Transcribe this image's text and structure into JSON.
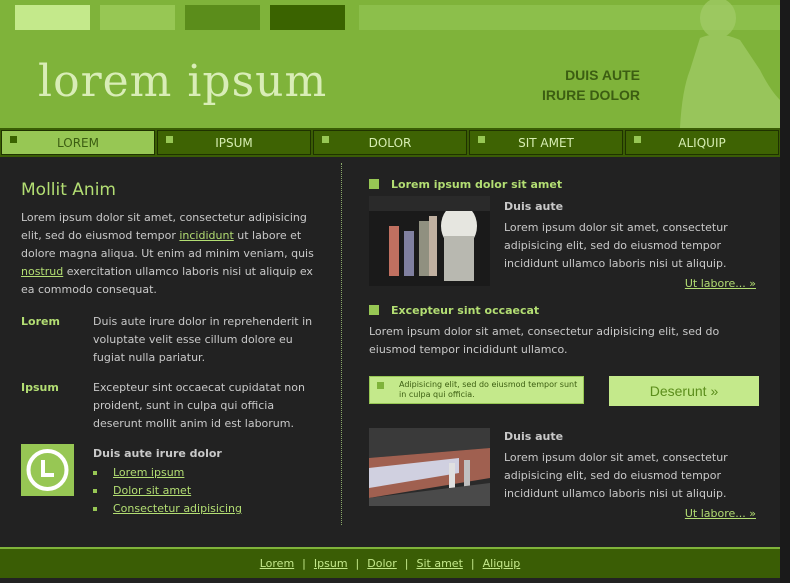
{
  "header": {
    "logo_text": "lorem ipsum",
    "tagline_line1": "DUIS AUTE",
    "tagline_line2": "IRURE DOLOR",
    "colors": {
      "light": "#c4e98b",
      "mid": "#97c754",
      "dark": "#5b8d1b",
      "darker": "#3a6300",
      "bg": "#7fb33a"
    }
  },
  "nav": {
    "items": [
      {
        "label": "LOREM",
        "active": true
      },
      {
        "label": "IPSUM",
        "active": false
      },
      {
        "label": "DOLOR",
        "active": false
      },
      {
        "label": "SIT AMET",
        "active": false
      },
      {
        "label": "ALIQUIP",
        "active": false
      }
    ]
  },
  "left": {
    "title": "Mollit Anim",
    "intro_part1": "Lorem ipsum dolor sit amet, consectetur adipisicing elit, sed do eiusmod tempor ",
    "intro_link1": "incididunt",
    "intro_part2": " ut labore et dolore magna aliqua. Ut enim ad minim veniam, quis ",
    "intro_link2": "nostrud",
    "intro_part3": " exercitation ullamco laboris nisi ut aliquip ex ea commodo consequat.",
    "defs": [
      {
        "term": "Lorem",
        "desc": "Duis aute irure dolor in reprehenderit in voluptate velit esse cillum dolore eu fugiat nulla pariatur."
      },
      {
        "term": "Ipsum",
        "desc": "Excepteur sint occaecat cupidatat non proident, sunt in culpa qui officia deserunt mollit anim id est laborum."
      }
    ],
    "links_heading": "Duis aute irure dolor",
    "links": [
      "Lorem ipsum",
      "Dolor sit amet",
      "Consectetur adipisicing"
    ],
    "icon": "clock-icon"
  },
  "right": {
    "section1_heading": "Lorem ipsum dolor sit amet",
    "article1": {
      "title": "Duis aute",
      "body": "Lorem ipsum dolor sit amet, consectetur adipisicing elit, sed do eiusmod tempor incididunt ullamco laboris nisi ut aliquip.",
      "more": "Ut labore... »"
    },
    "section2_heading": "Excepteur sint occaecat",
    "section2_body": "Lorem ipsum dolor sit amet, consectetur adipisicing elit, sed do eiusmod tempor incididunt ullamco.",
    "notice_text": "Adipisicing elit, sed do eiusmod tempor sunt in culpa qui officia.",
    "cta_label": "Deserunt »",
    "article2": {
      "title": "Duis aute",
      "body": "Lorem ipsum dolor sit amet, consectetur adipisicing elit, sed do eiusmod tempor incididunt ullamco laboris nisi ut aliquip.",
      "more": "Ut labore... »"
    }
  },
  "footer": {
    "links": [
      "Lorem",
      "Ipsum",
      "Dolor",
      "Sit amet",
      "Aliquip"
    ],
    "separator": "|"
  }
}
